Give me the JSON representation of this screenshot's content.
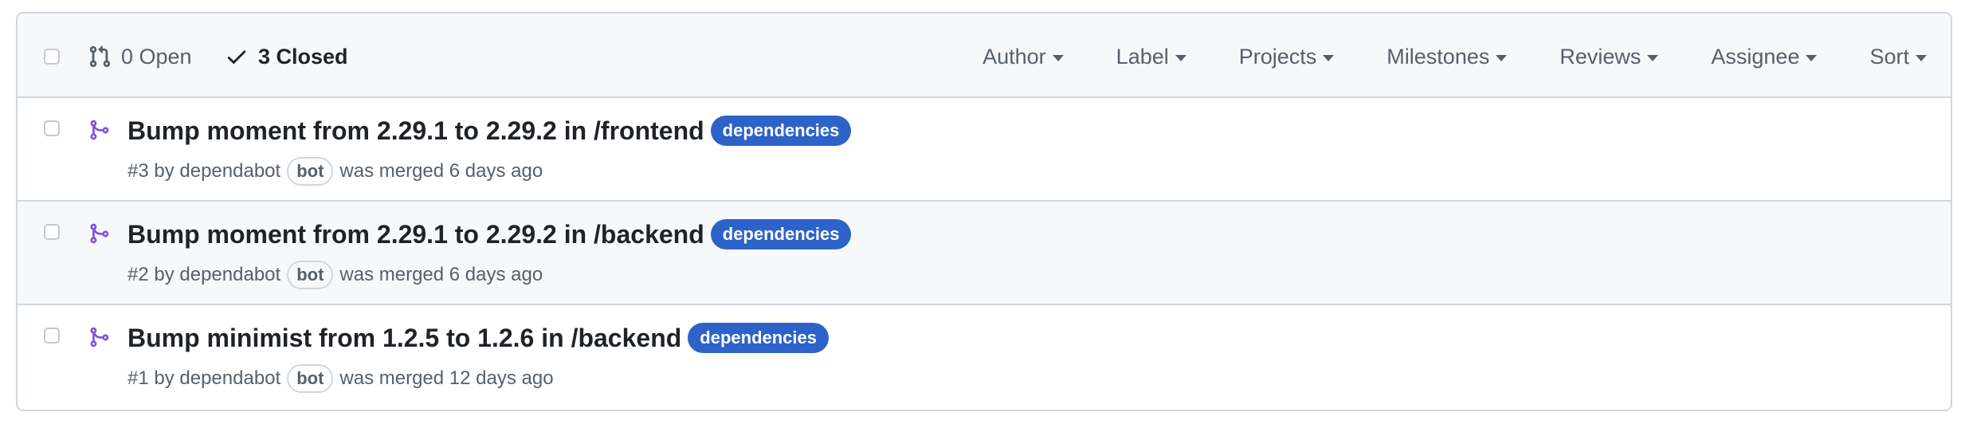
{
  "header": {
    "open_label": "0 Open",
    "closed_label": "3 Closed",
    "filters": [
      "Author",
      "Label",
      "Projects",
      "Milestones",
      "Reviews",
      "Assignee",
      "Sort"
    ]
  },
  "pull_requests": [
    {
      "title": "Bump moment from 2.29.1 to 2.29.2 in /frontend",
      "label": "dependencies",
      "number_by": "#3 by dependabot",
      "bot": "bot",
      "status": "was merged 6 days ago"
    },
    {
      "title": "Bump moment from 2.29.1 to 2.29.2 in /backend",
      "label": "dependencies",
      "number_by": "#2 by dependabot",
      "bot": "bot",
      "status": "was merged 6 days ago"
    },
    {
      "title": "Bump minimist from 1.2.5 to 1.2.6 in /backend",
      "label": "dependencies",
      "number_by": "#1 by dependabot",
      "bot": "bot",
      "status": "was merged 12 days ago"
    }
  ],
  "colors": {
    "label_bg": "#2d63c8",
    "merged_icon": "#8250df",
    "muted_text": "#57606a",
    "border": "#d0d7de"
  },
  "icons": {
    "open": "git-pull-request-icon",
    "closed": "check-icon",
    "row": "git-merge-icon"
  }
}
